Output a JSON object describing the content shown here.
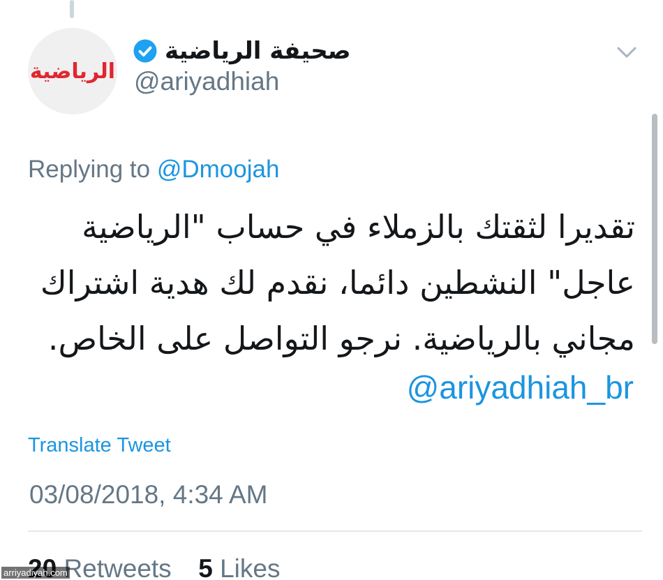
{
  "colors": {
    "link": "#1b95e0",
    "secondary_text": "#657786",
    "primary_text": "#14171a",
    "verified": "#1da1f2",
    "logo_red": "#e0262f"
  },
  "header": {
    "avatar_logo_text": "الرياضية",
    "display_name": "صحيفة الرياضية",
    "verified_icon": "verified-badge-icon",
    "handle": "@ariyadhiah",
    "menu_icon": "chevron-down-icon"
  },
  "reply": {
    "prefix": "Replying to",
    "mention": "@Dmoojah"
  },
  "tweet": {
    "text": "تقديرا لثقتك بالزملاء في حساب \"الرياضية عاجل\" النشطين دائما، نقدم لك هدية اشتراك مجاني بالرياضية. نرجو التواصل على الخاص.",
    "link": "@ariyadhiah_br",
    "translate_label": "Translate Tweet",
    "timestamp": "03/08/2018, 4:34 AM"
  },
  "stats": {
    "retweets_count": "20",
    "retweets_label": "Retweets",
    "likes_count": "5",
    "likes_label": "Likes"
  },
  "watermark": "arriyadiyah.com"
}
